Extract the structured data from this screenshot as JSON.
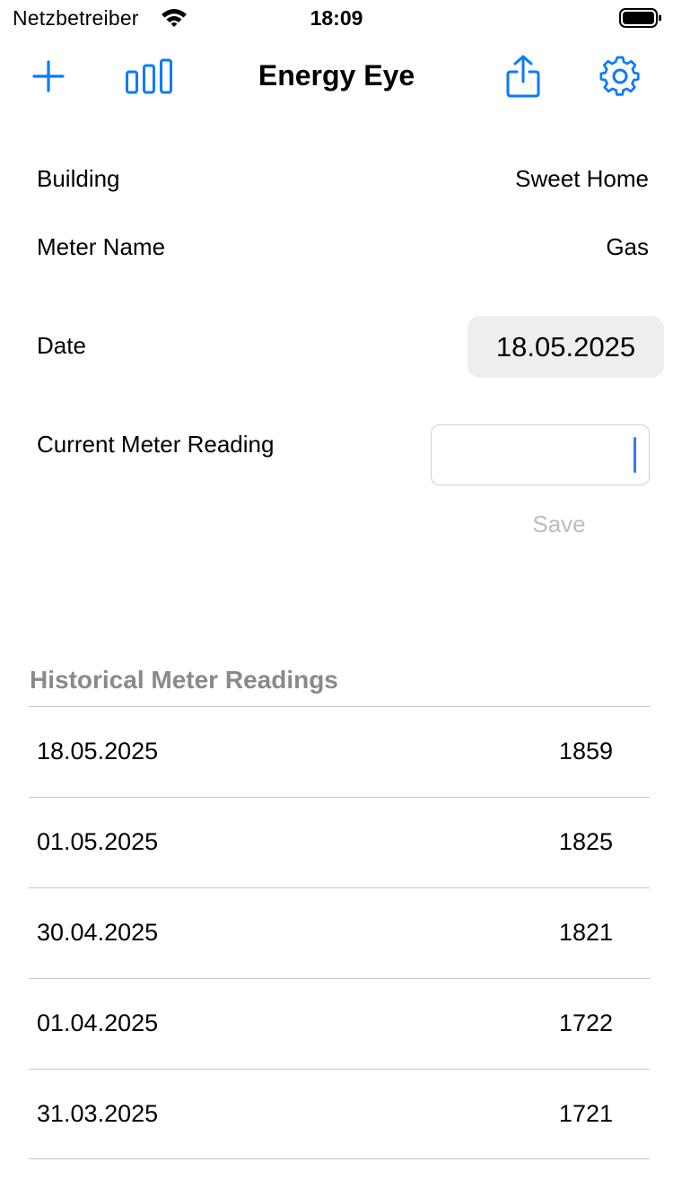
{
  "status_bar": {
    "carrier": "Netzbetreiber",
    "time": "18:09"
  },
  "nav_bar": {
    "title": "Energy Eye",
    "icons": [
      "plus-icon",
      "bar-chart-icon",
      "share-icon",
      "gear-icon"
    ],
    "accent_color": "#0a7aff"
  },
  "form": {
    "building": {
      "label": "Building",
      "value": "Sweet Home"
    },
    "meter_name": {
      "label": "Meter Name",
      "value": "Gas"
    },
    "date": {
      "label": "Date",
      "value": "18.05.2025"
    },
    "current_reading": {
      "label": "Current Meter Reading",
      "value": "",
      "placeholder": ""
    },
    "save_label": "Save"
  },
  "history": {
    "header": "Historical Meter Readings",
    "rows": [
      {
        "date": "18.05.2025",
        "value": "1859"
      },
      {
        "date": "01.05.2025",
        "value": "1825"
      },
      {
        "date": "30.04.2025",
        "value": "1821"
      },
      {
        "date": "01.04.2025",
        "value": "1722"
      },
      {
        "date": "31.03.2025",
        "value": "1721"
      }
    ]
  }
}
